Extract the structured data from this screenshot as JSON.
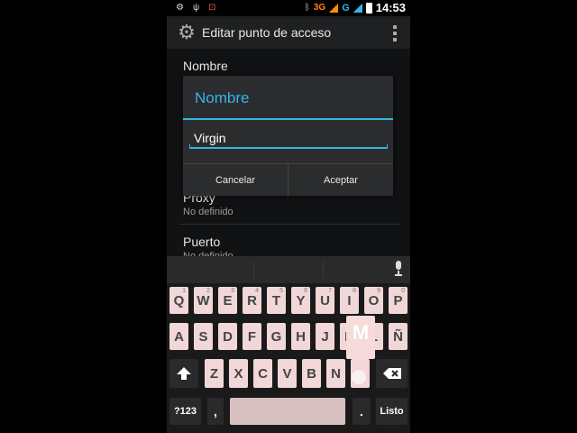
{
  "status_bar": {
    "time": "14:53",
    "network": "3G",
    "network2": "G"
  },
  "action_bar": {
    "title": "Editar punto de acceso"
  },
  "background_list": [
    {
      "title": "Nombre",
      "summary": ""
    },
    {
      "title": "Proxy",
      "summary": "No definido"
    },
    {
      "title": "Puerto",
      "summary": "No definido"
    }
  ],
  "dialog": {
    "title": "Nombre",
    "input_value": "Virgin",
    "cancel_label": "Cancelar",
    "accept_label": "Aceptar"
  },
  "keyboard": {
    "row1": [
      "Q",
      "W",
      "E",
      "R",
      "T",
      "Y",
      "U",
      "I",
      "O",
      "P"
    ],
    "row1_alt": [
      "1",
      "2",
      "3",
      "4",
      "5",
      "6",
      "7",
      "8",
      "9",
      "0"
    ],
    "row2": [
      "A",
      "S",
      "D",
      "F",
      "G",
      "H",
      "J",
      "K",
      "L",
      "Ñ"
    ],
    "row3": [
      "Z",
      "X",
      "C",
      "V",
      "B",
      "N",
      "M"
    ],
    "popup_key": "M",
    "symbols_label": "?123",
    "comma_label": ",",
    "period_label": ".",
    "done_label": "Listo",
    "shift_icon": "shift-arrow-icon",
    "delete_icon": "backspace-icon",
    "mic_icon": "microphone-icon"
  },
  "colors": {
    "accent": "#33b5e5",
    "key": "#f1d7d7",
    "network": "#ff8a00"
  }
}
